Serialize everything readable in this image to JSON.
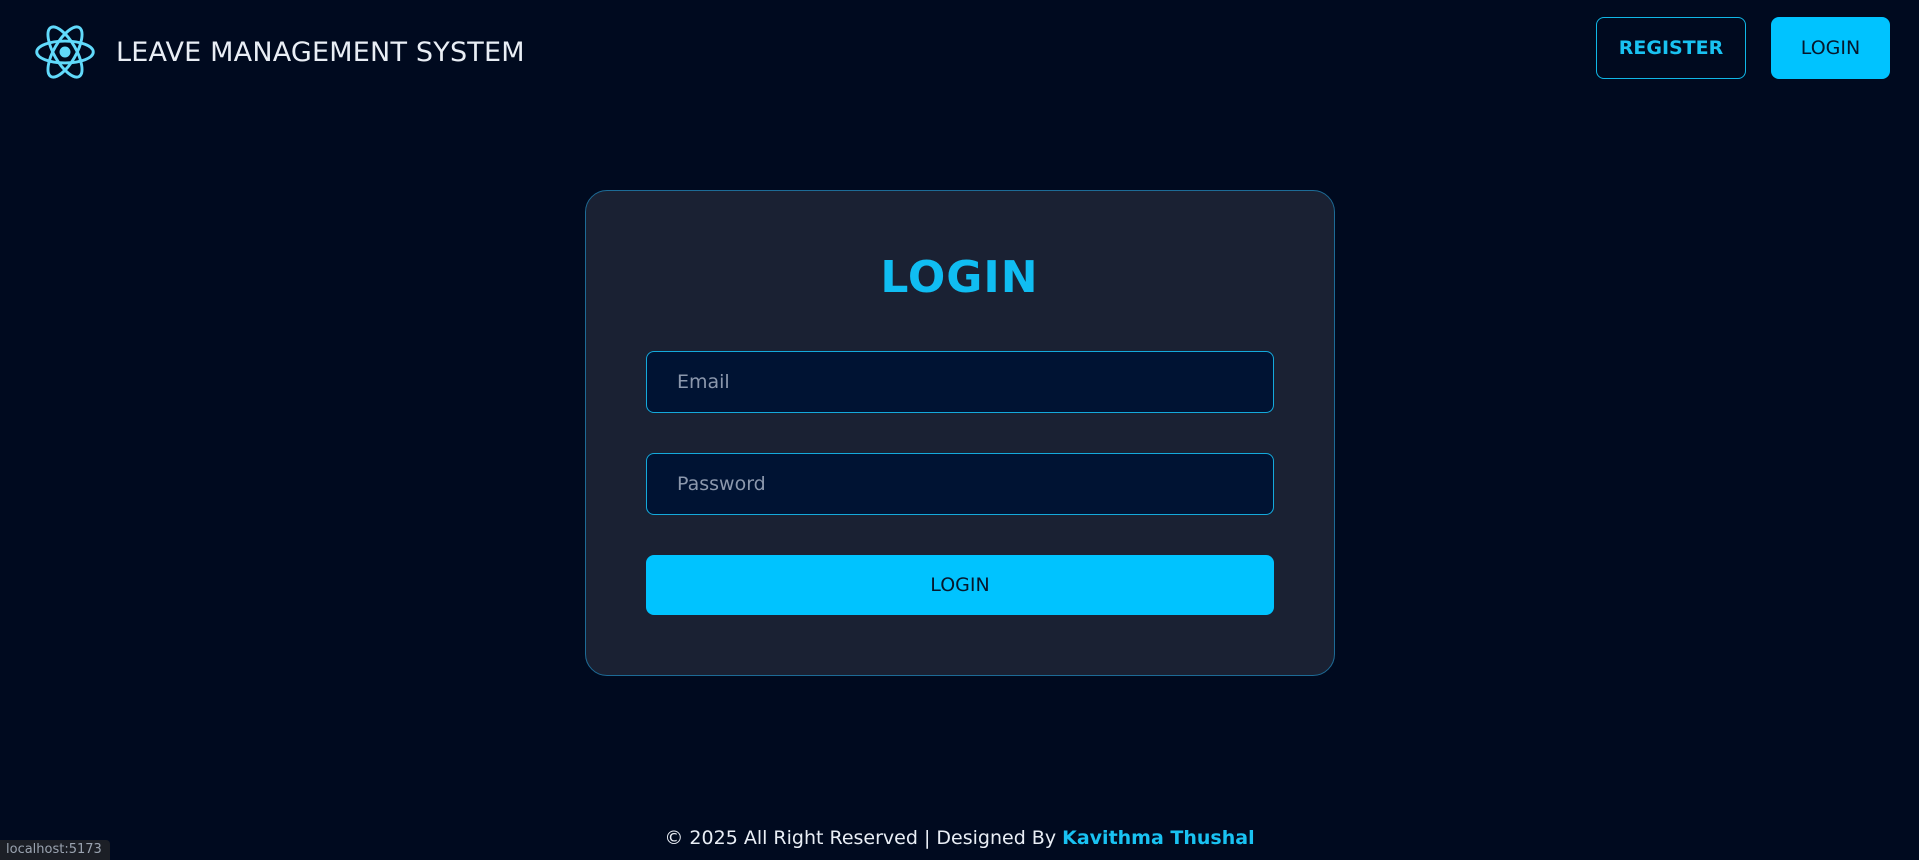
{
  "header": {
    "title": "LEAVE MANAGEMENT SYSTEM",
    "logo_icon": "react-atom-icon",
    "register_label": "REGISTER",
    "login_label": "LOGIN"
  },
  "login_form": {
    "title": "LOGIN",
    "email_placeholder": "Email",
    "password_placeholder": "Password",
    "submit_label": "LOGIN"
  },
  "footer": {
    "text": "© 2025 All Right Reserved | Designed By",
    "author": "Kavithma Thushal"
  },
  "status_bar": {
    "url": "localhost:5173"
  },
  "colors": {
    "background": "#000a1f",
    "card": "#1a2133",
    "accent": "#00c3ff",
    "input_background": "#001333"
  }
}
